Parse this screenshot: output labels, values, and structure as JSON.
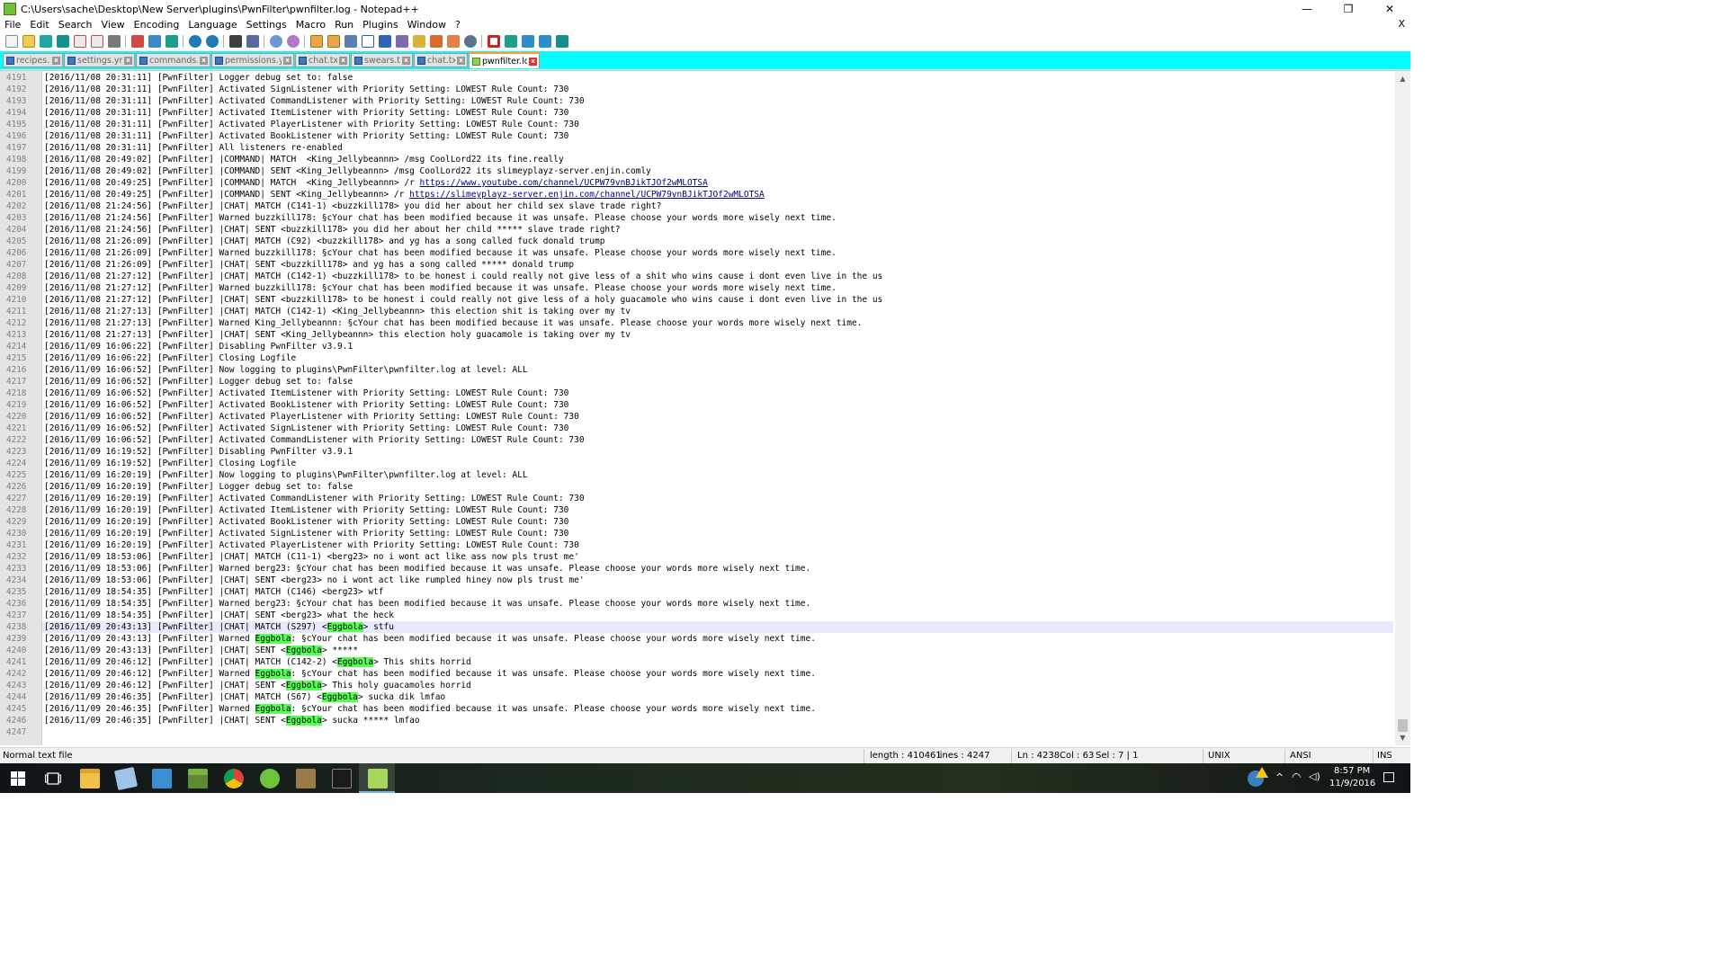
{
  "window": {
    "title": "C:\\Users\\sache\\Desktop\\New Server\\plugins\\PwnFilter\\pwnfilter.log - Notepad++",
    "minimize": "—",
    "maximize": "❐",
    "close": "✕"
  },
  "menu": [
    "File",
    "Edit",
    "Search",
    "View",
    "Encoding",
    "Language",
    "Settings",
    "Macro",
    "Run",
    "Plugins",
    "Window",
    "?"
  ],
  "menu_close": "X",
  "tabs": [
    {
      "label": "recipes.txt"
    },
    {
      "label": "settings.yml"
    },
    {
      "label": "commands.txt"
    },
    {
      "label": "permissions.yml"
    },
    {
      "label": "chat.txt"
    },
    {
      "label": "swears.txt"
    },
    {
      "label": "chat.txt"
    },
    {
      "label": "pwnfilter.log"
    }
  ],
  "tab_close_glyph": "x",
  "editor": {
    "lines": [
      {
        "n": "4191",
        "t": "[2016/11/08 20:31:11] [PwnFilter] Logger debug set to: false"
      },
      {
        "n": "4192",
        "t": "[2016/11/08 20:31:11] [PwnFilter] Activated SignListener with Priority Setting: LOWEST Rule Count: 730"
      },
      {
        "n": "4193",
        "t": "[2016/11/08 20:31:11] [PwnFilter] Activated CommandListener with Priority Setting: LOWEST Rule Count: 730"
      },
      {
        "n": "4194",
        "t": "[2016/11/08 20:31:11] [PwnFilter] Activated ItemListener with Priority Setting: LOWEST Rule Count: 730"
      },
      {
        "n": "4195",
        "t": "[2016/11/08 20:31:11] [PwnFilter] Activated PlayerListener with Priority Setting: LOWEST Rule Count: 730"
      },
      {
        "n": "4196",
        "t": "[2016/11/08 20:31:11] [PwnFilter] Activated BookListener with Priority Setting: LOWEST Rule Count: 730"
      },
      {
        "n": "4197",
        "t": "[2016/11/08 20:31:11] [PwnFilter] All listeners re-enabled"
      },
      {
        "n": "4198",
        "t": "[2016/11/08 20:49:02] [PwnFilter] |COMMAND| MATCH  <King_Jellybeannn> /msg CoolLord22 its fine.really"
      },
      {
        "n": "4199",
        "t": "[2016/11/08 20:49:02] [PwnFilter] |COMMAND| SENT <King_Jellybeannn> /msg CoolLord22 its slimeyplayz-server.enjin.comly"
      },
      {
        "n": "4200",
        "t": "[2016/11/08 20:49:25] [PwnFilter] |COMMAND| MATCH  <King_Jellybeannn> /r ",
        "link": "https://www.youtube.com/channel/UCPW79vnBJikTJOf2wMLOTSA"
      },
      {
        "n": "4201",
        "t": "[2016/11/08 20:49:25] [PwnFilter] |COMMAND| SENT <King_Jellybeannn> /r ",
        "link": "https://slimeyplayz-server.enjin.com/channel/UCPW79vnBJikTJOf2wMLOTSA"
      },
      {
        "n": "4202",
        "t": "[2016/11/08 21:24:56] [PwnFilter] |CHAT| MATCH (C141-1) <buzzkill178> you did her about her child sex slave trade right?"
      },
      {
        "n": "4203",
        "t": "[2016/11/08 21:24:56] [PwnFilter] Warned buzzkill178: §cYour chat has been modified because it was unsafe. Please choose your words more wisely next time."
      },
      {
        "n": "4204",
        "t": "[2016/11/08 21:24:56] [PwnFilter] |CHAT| SENT <buzzkill178> you did her about her child ***** slave trade right?"
      },
      {
        "n": "4205",
        "t": "[2016/11/08 21:26:09] [PwnFilter] |CHAT| MATCH (C92) <buzzkill178> and yg has a song called fuck donald trump"
      },
      {
        "n": "4206",
        "t": "[2016/11/08 21:26:09] [PwnFilter] Warned buzzkill178: §cYour chat has been modified because it was unsafe. Please choose your words more wisely next time."
      },
      {
        "n": "4207",
        "t": "[2016/11/08 21:26:09] [PwnFilter] |CHAT| SENT <buzzkill178> and yg has a song called ***** donald trump"
      },
      {
        "n": "4208",
        "t": "[2016/11/08 21:27:12] [PwnFilter] |CHAT| MATCH (C142-1) <buzzkill178> to be honest i could really not give less of a shit who wins cause i dont even live in the us"
      },
      {
        "n": "4209",
        "t": "[2016/11/08 21:27:12] [PwnFilter] Warned buzzkill178: §cYour chat has been modified because it was unsafe. Please choose your words more wisely next time."
      },
      {
        "n": "4210",
        "t": "[2016/11/08 21:27:12] [PwnFilter] |CHAT| SENT <buzzkill178> to be honest i could really not give less of a holy guacamole who wins cause i dont even live in the us"
      },
      {
        "n": "4211",
        "t": "[2016/11/08 21:27:13] [PwnFilter] |CHAT| MATCH (C142-1) <King_Jellybeannn> this election shit is taking over my tv"
      },
      {
        "n": "4212",
        "t": "[2016/11/08 21:27:13] [PwnFilter] Warned King_Jellybeannn: §cYour chat has been modified because it was unsafe. Please choose your words more wisely next time."
      },
      {
        "n": "4213",
        "t": "[2016/11/08 21:27:13] [PwnFilter] |CHAT| SENT <King_Jellybeannn> this election holy guacamole is taking over my tv"
      },
      {
        "n": "4214",
        "t": "[2016/11/09 16:06:22] [PwnFilter] Disabling PwnFilter v3.9.1"
      },
      {
        "n": "4215",
        "t": "[2016/11/09 16:06:22] [PwnFilter] Closing Logfile"
      },
      {
        "n": "4216",
        "t": "[2016/11/09 16:06:52] [PwnFilter] Now logging to plugins\\PwnFilter\\pwnfilter.log at level: ALL"
      },
      {
        "n": "4217",
        "t": "[2016/11/09 16:06:52] [PwnFilter] Logger debug set to: false"
      },
      {
        "n": "4218",
        "t": "[2016/11/09 16:06:52] [PwnFilter] Activated ItemListener with Priority Setting: LOWEST Rule Count: 730"
      },
      {
        "n": "4219",
        "t": "[2016/11/09 16:06:52] [PwnFilter] Activated BookListener with Priority Setting: LOWEST Rule Count: 730"
      },
      {
        "n": "4220",
        "t": "[2016/11/09 16:06:52] [PwnFilter] Activated PlayerListener with Priority Setting: LOWEST Rule Count: 730"
      },
      {
        "n": "4221",
        "t": "[2016/11/09 16:06:52] [PwnFilter] Activated SignListener with Priority Setting: LOWEST Rule Count: 730"
      },
      {
        "n": "4222",
        "t": "[2016/11/09 16:06:52] [PwnFilter] Activated CommandListener with Priority Setting: LOWEST Rule Count: 730"
      },
      {
        "n": "4223",
        "t": "[2016/11/09 16:19:52] [PwnFilter] Disabling PwnFilter v3.9.1"
      },
      {
        "n": "4224",
        "t": "[2016/11/09 16:19:52] [PwnFilter] Closing Logfile"
      },
      {
        "n": "4225",
        "t": "[2016/11/09 16:20:19] [PwnFilter] Now logging to plugins\\PwnFilter\\pwnfilter.log at level: ALL"
      },
      {
        "n": "4226",
        "t": "[2016/11/09 16:20:19] [PwnFilter] Logger debug set to: false"
      },
      {
        "n": "4227",
        "t": "[2016/11/09 16:20:19] [PwnFilter] Activated CommandListener with Priority Setting: LOWEST Rule Count: 730"
      },
      {
        "n": "4228",
        "t": "[2016/11/09 16:20:19] [PwnFilter] Activated ItemListener with Priority Setting: LOWEST Rule Count: 730"
      },
      {
        "n": "4229",
        "t": "[2016/11/09 16:20:19] [PwnFilter] Activated BookListener with Priority Setting: LOWEST Rule Count: 730"
      },
      {
        "n": "4230",
        "t": "[2016/11/09 16:20:19] [PwnFilter] Activated SignListener with Priority Setting: LOWEST Rule Count: 730"
      },
      {
        "n": "4231",
        "t": "[2016/11/09 16:20:19] [PwnFilter] Activated PlayerListener with Priority Setting: LOWEST Rule Count: 730"
      },
      {
        "n": "4232",
        "t": "[2016/11/09 18:53:06] [PwnFilter] |CHAT| MATCH (C11-1) <berg23> no i wont act like ass now pls trust me'"
      },
      {
        "n": "4233",
        "t": "[2016/11/09 18:53:06] [PwnFilter] Warned berg23: §cYour chat has been modified because it was unsafe. Please choose your words more wisely next time."
      },
      {
        "n": "4234",
        "t": "[2016/11/09 18:53:06] [PwnFilter] |CHAT| SENT <berg23> no i wont act like rumpled hiney now pls trust me'"
      },
      {
        "n": "4235",
        "t": "[2016/11/09 18:54:35] [PwnFilter] |CHAT| MATCH (C146) <berg23> wtf"
      },
      {
        "n": "4236",
        "t": "[2016/11/09 18:54:35] [PwnFilter] Warned berg23: §cYour chat has been modified because it was unsafe. Please choose your words more wisely next time."
      },
      {
        "n": "4237",
        "t": "[2016/11/09 18:54:35] [PwnFilter] |CHAT| SENT <berg23> what the heck"
      },
      {
        "n": "4238",
        "pre": "[2016/11/09 20:43:13] [PwnFilter] |CHAT| MATCH (S297) <",
        "hl": "Eggbola",
        "post": "> stfu",
        "current": true
      },
      {
        "n": "4239",
        "pre": "[2016/11/09 20:43:13] [PwnFilter] Warned ",
        "hl": "Eggbola",
        "post": ": §cYour chat has been modified because it was unsafe. Please choose your words more wisely next time."
      },
      {
        "n": "4240",
        "pre": "[2016/11/09 20:43:13] [PwnFilter] |CHAT| SENT <",
        "hl": "Eggbola",
        "post": "> *****"
      },
      {
        "n": "4241",
        "pre": "[2016/11/09 20:46:12] [PwnFilter] |CHAT| MATCH (C142-2) <",
        "hl": "Eggbola",
        "post": "> This shits horrid"
      },
      {
        "n": "4242",
        "pre": "[2016/11/09 20:46:12] [PwnFilter] Warned ",
        "hl": "Eggbola",
        "post": ": §cYour chat has been modified because it was unsafe. Please choose your words more wisely next time."
      },
      {
        "n": "4243",
        "pre": "[2016/11/09 20:46:12] [PwnFilter] |CHAT| SENT <",
        "hl": "Eggbola",
        "post": "> This holy guacamoles horrid"
      },
      {
        "n": "4244",
        "pre": "[2016/11/09 20:46:35] [PwnFilter] |CHAT| MATCH (S67) <",
        "hl": "Eggbola",
        "post": "> sucka dik lmfao"
      },
      {
        "n": "4245",
        "pre": "[2016/11/09 20:46:35] [PwnFilter] Warned ",
        "hl": "Eggbola",
        "post": ": §cYour chat has been modified because it was unsafe. Please choose your words more wisely next time."
      },
      {
        "n": "4246",
        "pre": "[2016/11/09 20:46:35] [PwnFilter] |CHAT| SENT <",
        "hl": "Eggbola",
        "post": "> sucka ***** lmfao"
      },
      {
        "n": "4247",
        "t": ""
      }
    ]
  },
  "status": {
    "file_type": "Normal text file",
    "length": "length : 410461",
    "lines": "lines : 4247",
    "ln": "Ln : 4238",
    "col": "Col : 63",
    "sel": "Sel : 7 | 1",
    "eol": "UNIX",
    "encoding": "ANSI",
    "mode": "INS"
  },
  "taskbar": {
    "time": "8:57 PM",
    "date": "11/9/2016"
  },
  "colors": {
    "tabbar_bg": "#00ffff",
    "highlight": "#55ff55",
    "current_line": "#e8e8ff",
    "gutter_bg": "#e4e4e4"
  }
}
